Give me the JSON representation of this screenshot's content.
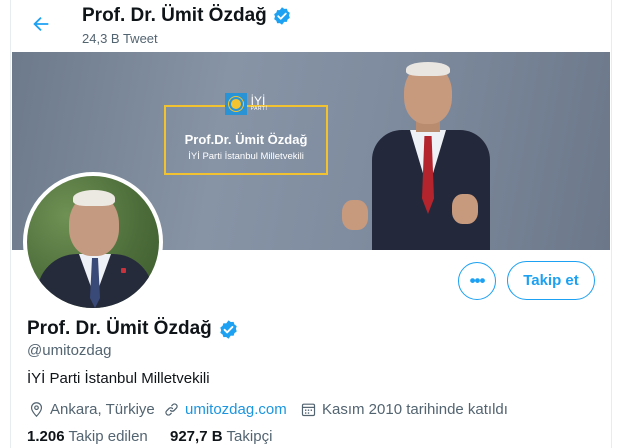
{
  "header": {
    "name": "Prof. Dr. Ümit Özdağ",
    "tweet_count": "24,3 B Tweet"
  },
  "banner": {
    "party_mark": "İYİ",
    "party_sub": "PARTİ",
    "name": "Prof.Dr. Ümit Özdağ",
    "subtitle": "İYİ Parti İstanbul Milletvekili"
  },
  "profile": {
    "name": "Prof. Dr. Ümit Özdağ",
    "handle": "@umitozdag",
    "bio": "İYİ Parti İstanbul Milletvekili",
    "location": "Ankara, Türkiye",
    "url": "umitozdag.com",
    "joined": "Kasım 2010 tarihinde katıldı",
    "following_count": "1.206",
    "following_label": "Takip edilen",
    "followers_count": "927,7 B",
    "followers_label": "Takipçi"
  },
  "actions": {
    "more": "•••",
    "follow": "Takip et"
  },
  "icons": {
    "back": "arrow-left-icon",
    "verified": "verified-badge-icon",
    "location": "location-pin-icon",
    "link": "link-icon",
    "calendar": "calendar-icon"
  },
  "colors": {
    "accent": "#1da1f2",
    "text_secondary": "#536471",
    "link": "#1b95e0"
  }
}
